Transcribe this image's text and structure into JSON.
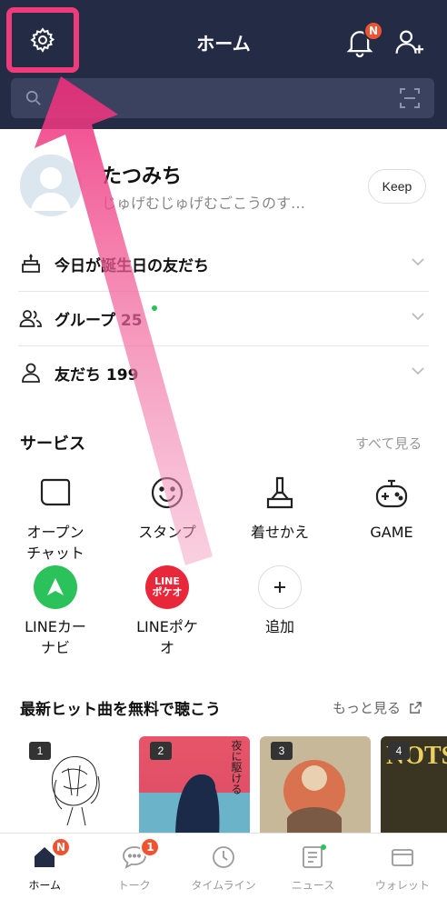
{
  "header": {
    "title": "ホーム",
    "notification_badge": "N",
    "search_placeholder": ""
  },
  "profile": {
    "name": "たつみち",
    "status": "じゅげむじゅげむごこうのす…",
    "keep_label": "Keep"
  },
  "rows": [
    {
      "label": "今日が誕生日の友だち",
      "icon": "cake-icon"
    },
    {
      "label": "グループ 25",
      "icon": "group-icon"
    },
    {
      "label": "友だち 199",
      "icon": "person-icon"
    }
  ],
  "services": {
    "title": "サービス",
    "link": "すべて見る",
    "items": [
      {
        "label": "オープン\nチャット",
        "icon": "open-chat-icon"
      },
      {
        "label": "スタンプ",
        "icon": "sticker-smile-icon"
      },
      {
        "label": "着せかえ",
        "icon": "theme-brush-icon"
      },
      {
        "label": "GAME",
        "icon": "gamepad-icon"
      },
      {
        "label": "LINEカー\nナビ",
        "icon": "line-car-navi-icon"
      },
      {
        "label": "LINEポケ\nオ",
        "icon": "line-pokeo-icon",
        "icon_text": "LINE\nポケオ"
      },
      {
        "label": "追加",
        "icon": "plus-icon"
      }
    ]
  },
  "music": {
    "title": "最新ヒット曲を無料で聴こう",
    "link": "もっと見る",
    "albums": [
      {
        "rank": "1",
        "art_text": ""
      },
      {
        "rank": "2",
        "art_text": "夜に駆ける"
      },
      {
        "rank": "3",
        "art_text": ""
      },
      {
        "rank": "4",
        "art_text": "NOTS"
      }
    ]
  },
  "bottom_nav": [
    {
      "label": "ホーム",
      "icon": "home-icon",
      "badge": "N",
      "active": true
    },
    {
      "label": "トーク",
      "icon": "chat-bubble-icon",
      "badge": "1",
      "active": false
    },
    {
      "label": "タイムライン",
      "icon": "clock-icon",
      "badge": "",
      "active": false
    },
    {
      "label": "ニュース",
      "icon": "news-icon",
      "badge": "",
      "active": false
    },
    {
      "label": "ウォレット",
      "icon": "wallet-icon",
      "badge": "",
      "active": false
    }
  ],
  "colors": {
    "header_bg": "#232b45",
    "highlight_pink": "#ef3b7a",
    "badge_red": "#f0532f",
    "line_green": "#2bc15b"
  }
}
